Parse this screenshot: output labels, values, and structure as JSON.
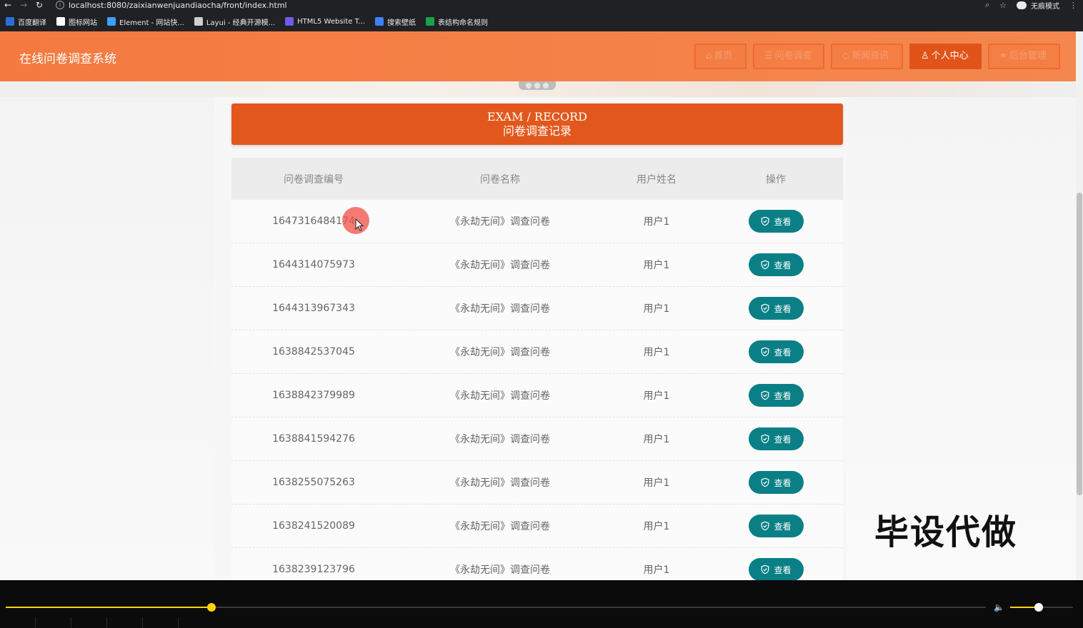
{
  "browser": {
    "url": "localhost:8080/zaixianwenjuandiaocha/front/index.html",
    "incognito_label": "无痕模式",
    "bookmarks": [
      {
        "label": "百度翻译",
        "color": "#2b6fd6"
      },
      {
        "label": "图标网站",
        "color": "#ffffff"
      },
      {
        "label": "Element - 网站快...",
        "color": "#409eff"
      },
      {
        "label": "Layui - 经典开源模...",
        "color": "#cfcfcf"
      },
      {
        "label": "HTML5 Website T...",
        "color": "#6c5ce7"
      },
      {
        "label": "搜索壁纸",
        "color": "#3b82f6"
      },
      {
        "label": "表结构命名规则",
        "color": "#16a34a"
      }
    ]
  },
  "header": {
    "site_title": "在线问卷调查系统",
    "nav": [
      {
        "label": "首页",
        "icon": "home-icon",
        "active": false
      },
      {
        "label": "问卷调查",
        "icon": "list-icon",
        "active": false
      },
      {
        "label": "新闻资讯",
        "icon": "news-icon",
        "active": false
      },
      {
        "label": "个人中心",
        "icon": "user-icon",
        "active": true
      },
      {
        "label": "后台管理",
        "icon": "link-icon",
        "active": false
      }
    ]
  },
  "section": {
    "title_en": "EXAM / RECORD",
    "title_zh": "问卷调查记录"
  },
  "table": {
    "columns": [
      "问卷调查编号",
      "问卷名称",
      "用户姓名",
      "操作"
    ],
    "view_label": "查看",
    "rows": [
      {
        "id": "1647316484174",
        "name": "《永劫无间》调查问卷",
        "user": "用户1"
      },
      {
        "id": "1644314075973",
        "name": "《永劫无间》调查问卷",
        "user": "用户1"
      },
      {
        "id": "1644313967343",
        "name": "《永劫无间》调查问卷",
        "user": "用户1"
      },
      {
        "id": "1638842537045",
        "name": "《永劫无间》调查问卷",
        "user": "用户1"
      },
      {
        "id": "1638842379989",
        "name": "《永劫无间》调查问卷",
        "user": "用户1"
      },
      {
        "id": "1638841594276",
        "name": "《永劫无间》调查问卷",
        "user": "用户1"
      },
      {
        "id": "1638255075263",
        "name": "《永劫无间》调查问卷",
        "user": "用户1"
      },
      {
        "id": "1638241520089",
        "name": "《永劫无间》调查问卷",
        "user": "用户1"
      },
      {
        "id": "1638239123796",
        "name": "《永劫无间》调查问卷",
        "user": "用户1"
      }
    ]
  },
  "watermark": "毕设代做",
  "player": {
    "progress": 0.21,
    "volume": 0.45,
    "accent_color": "#ffd400"
  },
  "colors": {
    "header": "#f47a40",
    "section_head": "#e2581c",
    "view_button": "#0a7f86"
  }
}
